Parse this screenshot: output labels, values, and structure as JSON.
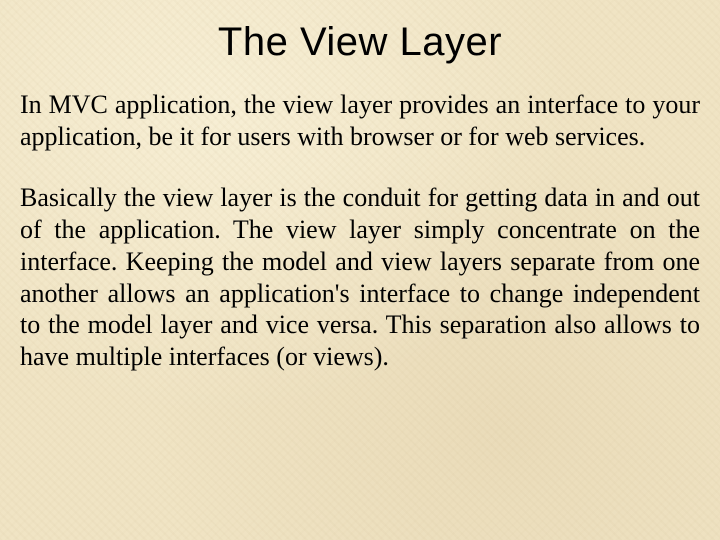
{
  "title": "The View Layer",
  "paragraphs": [
    "In MVC application, the view layer provides an interface to your application, be it for users with browser or for web services.",
    "Basically the view layer is the conduit for getting data in and out of the application. The view layer simply concentrate on the interface.\nKeeping the model and view layers separate from one another allows an application's interface to change independent to the model layer and vice versa. This separation also allows to have multiple interfaces (or views)."
  ]
}
